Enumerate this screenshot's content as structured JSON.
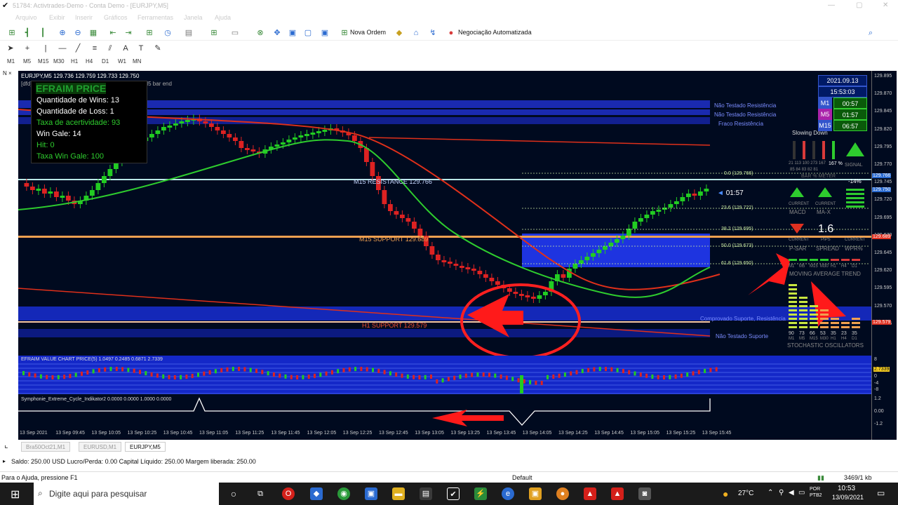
{
  "window": {
    "title": "51784: Activtrades-Demo - Conta Demo - [EURJPY,M5]"
  },
  "menu": [
    "Arquivo",
    "Exibir",
    "Inserir",
    "Gráficos",
    "Ferramentas",
    "Janela",
    "Ajuda"
  ],
  "toolbar": {
    "new_order": "Nova Ordem",
    "auto_trading": "Negociação Automatizada"
  },
  "timeframes": [
    "M1",
    "M5",
    "M15",
    "M30",
    "H1",
    "H4",
    "D1",
    "W1",
    "MN"
  ],
  "chart": {
    "symbol_header": "EURJPY,M5  129.736 129.759 129.733 129.750",
    "sub_header": "[dfd]",
    "sub_header2": "ds left to M5 bar end",
    "countdown": "01:57",
    "levels": {
      "m15_res": "M15 RESISTANCE 129.766",
      "m15_sup": "M15 SUPPORT 129.689",
      "h1_sup": "H1 SUPPORT 129.579"
    },
    "zones": [
      "Não Testado Resistência",
      "Não Testado Resistência",
      "Fraco Resistência",
      "Comprovado Suporte, Resistência",
      "Não Testado Suporte"
    ],
    "fibo": [
      "0.0 (129.766)",
      "23.6 (129.722)",
      "38.2 (129.695)",
      "50.0 (129.673)",
      "61.8 (129.650)"
    ],
    "price_ticks": [
      "129.895",
      "129.870",
      "129.845",
      "129.820",
      "129.795",
      "129.770",
      "129.745",
      "129.720",
      "129.695",
      "129.670",
      "129.645",
      "129.620",
      "129.595",
      "129.570",
      "129.545"
    ],
    "price_tags": {
      "current": "129.750",
      "top": "129.766",
      "mid": "129.689",
      "low": "129.579"
    },
    "colors": {
      "bg": "#000a1f",
      "band": "#1a2ab0",
      "bull": "#22cc22",
      "bear": "#dd2222",
      "ma_red": "#e0301a",
      "ma_green": "#2ecc2e"
    }
  },
  "info": {
    "title": "EFRAIM PRICE",
    "rows": [
      {
        "label": "Quantidade de Wins: 13",
        "color": "#ffffff"
      },
      {
        "label": "Quantidade de Loss: 1",
        "color": "#ffffff"
      },
      {
        "label": "Taxa de acertividade: 93",
        "color": "#2ecc2e"
      },
      {
        "label": "Win Gale: 14",
        "color": "#ffffff"
      },
      {
        "label": "Hit: 0",
        "color": "#2ecc2e"
      },
      {
        "label": "Taxa Win Gale: 100",
        "color": "#2ecc2e"
      }
    ]
  },
  "timepanel": {
    "date": "2021.09.13",
    "time": "15:53:03",
    "rows": [
      {
        "tf": "M1",
        "val": "00:57",
        "color": "#3355cc"
      },
      {
        "tf": "M5",
        "val": "01:57",
        "color": "#aa22aa"
      },
      {
        "tf": "M15",
        "val": "06:57",
        "color": "#3355cc"
      }
    ]
  },
  "dashboard": {
    "slowing": "Slowing Down",
    "bar_nums": "21 113 100 273 167",
    "bar_nums2": "85 84 83 82 81",
    "pct": "167 %",
    "signal": "SIGNAL",
    "bar_meter": "BAR % METER",
    "neg14": "-14%",
    "current": "CURRENT",
    "macd": "MACD",
    "max": "MA-X",
    "psar": "P-SAR",
    "pips": "PIPS",
    "spread": "SPREAD",
    "wpr": "WPR%",
    "spread_val": "1.6",
    "tfs": [
      "M1",
      "M5",
      "M15",
      "M30",
      "H1",
      "H4",
      "D1"
    ],
    "ma_trend": "MOVING AVERAGE TREND",
    "stoch_vals": [
      "90",
      "73",
      "66",
      "53",
      "35",
      "23",
      "35"
    ],
    "stoch_tfs": [
      "M1",
      "M5",
      "M15",
      "M30",
      "H1",
      "H4",
      "D1"
    ],
    "stoch": "STOCHASTIC OSCILLATORS"
  },
  "subwin1": {
    "header": "EFRAIM VALUE CHART PRICE(5) 1.0497 0.2485 0.6871 2.7339",
    "tag": "2.7339",
    "ticks": [
      "8",
      "4",
      "0",
      "-4",
      "-8"
    ]
  },
  "subwin2": {
    "header": "Symphonie_Extreme_Cycle_Indikator2 0.0000 0.0000 1.0000 0.0000",
    "ticks": [
      "1.2",
      "0.00",
      "-1.2"
    ]
  },
  "time_axis": [
    "13 Sep 2021",
    "13 Sep 09:45",
    "13 Sep 10:05",
    "13 Sep 10:25",
    "13 Sep 10:45",
    "13 Sep 11:05",
    "13 Sep 11:25",
    "13 Sep 11:45",
    "13 Sep 12:05",
    "13 Sep 12:25",
    "13 Sep 12:45",
    "13 Sep 13:05",
    "13 Sep 13:25",
    "13 Sep 13:45",
    "13 Sep 14:05",
    "13 Sep 14:25",
    "13 Sep 14:45",
    "13 Sep 15:05",
    "13 Sep 15:25",
    "13 Sep 15:45"
  ],
  "tabs": [
    "Bra50Oct21,M1",
    "EURUSD,M1",
    "EURJPY,M5"
  ],
  "account": "Saldo: 250.00 USD  Lucro/Perda: 0.00  Capital Líquido: 250.00  Margem liberada: 250.00",
  "status": {
    "help": "Para o Ajuda, pressione F1",
    "profile": "Default",
    "traffic": "3469/1 kb"
  },
  "taskbar": {
    "search": "Digite aqui para pesquisar",
    "temp": "27°C",
    "lang": "POR PTB2",
    "time": "10:53",
    "date": "13/09/2021"
  }
}
